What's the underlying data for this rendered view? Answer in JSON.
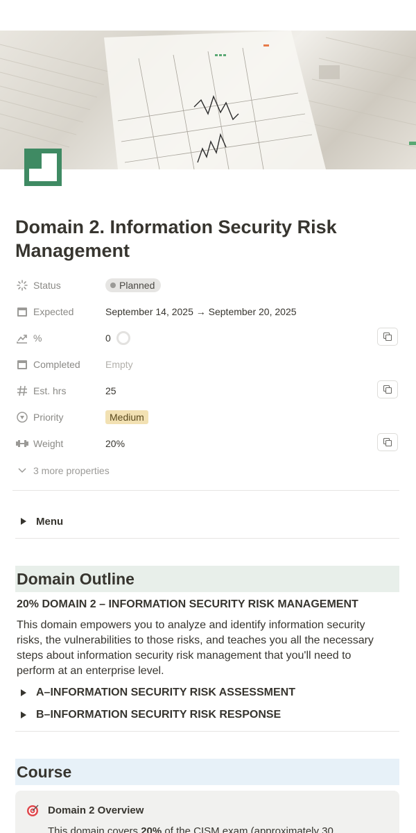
{
  "page": {
    "title": "Domain 2. Information Security Risk Management"
  },
  "properties": [
    {
      "icon": "loading-icon",
      "name": "Status",
      "value": "Planned",
      "kind": "status"
    },
    {
      "icon": "calendar-icon",
      "name": "Expected",
      "value": "September 14, 2025 → September 20, 2025",
      "kind": "text"
    },
    {
      "icon": "trend-icon",
      "name": "%",
      "value": "0",
      "kind": "progress",
      "progress": 0
    },
    {
      "icon": "calendar-icon",
      "name": "Completed",
      "value": "Empty",
      "kind": "empty"
    },
    {
      "icon": "hash-icon",
      "name": "Est. hrs",
      "value": "25",
      "kind": "text"
    },
    {
      "icon": "priority-icon",
      "name": "Priority",
      "value": "Medium",
      "kind": "select"
    },
    {
      "icon": "weight-icon",
      "name": "Weight",
      "value": "20%",
      "kind": "text"
    }
  ],
  "more_properties": "3 more properties",
  "menu_toggle": "Menu",
  "outline": {
    "heading": "Domain Outline",
    "subheading": "20% DOMAIN 2 – INFORMATION SECURITY RISK MANAGEMENT",
    "paragraph": "This domain empowers you to analyze and identify information security risks, the vulnerabilities to those risks, and teaches you all the necessary steps about information security risk management that you'll need to perform at an enterprise level.",
    "toggles": [
      "A–INFORMATION SECURITY RISK ASSESSMENT",
      "B–INFORMATION SECURITY RISK RESPONSE"
    ]
  },
  "course": {
    "heading": "Course",
    "callout_title": "Domain 2 Overview",
    "callout_text_pre": "This domain covers ",
    "callout_text_bold": "20%",
    "callout_text_post": " of the CISM exam (approximately 30"
  },
  "colors": {
    "page_icon": "#3f8a63",
    "heading_outline_bg": "#e8efea",
    "heading_course_bg": "#e7f1f8",
    "status_pill": "#e6e5e3",
    "priority_medium": "#f2e1b3"
  }
}
